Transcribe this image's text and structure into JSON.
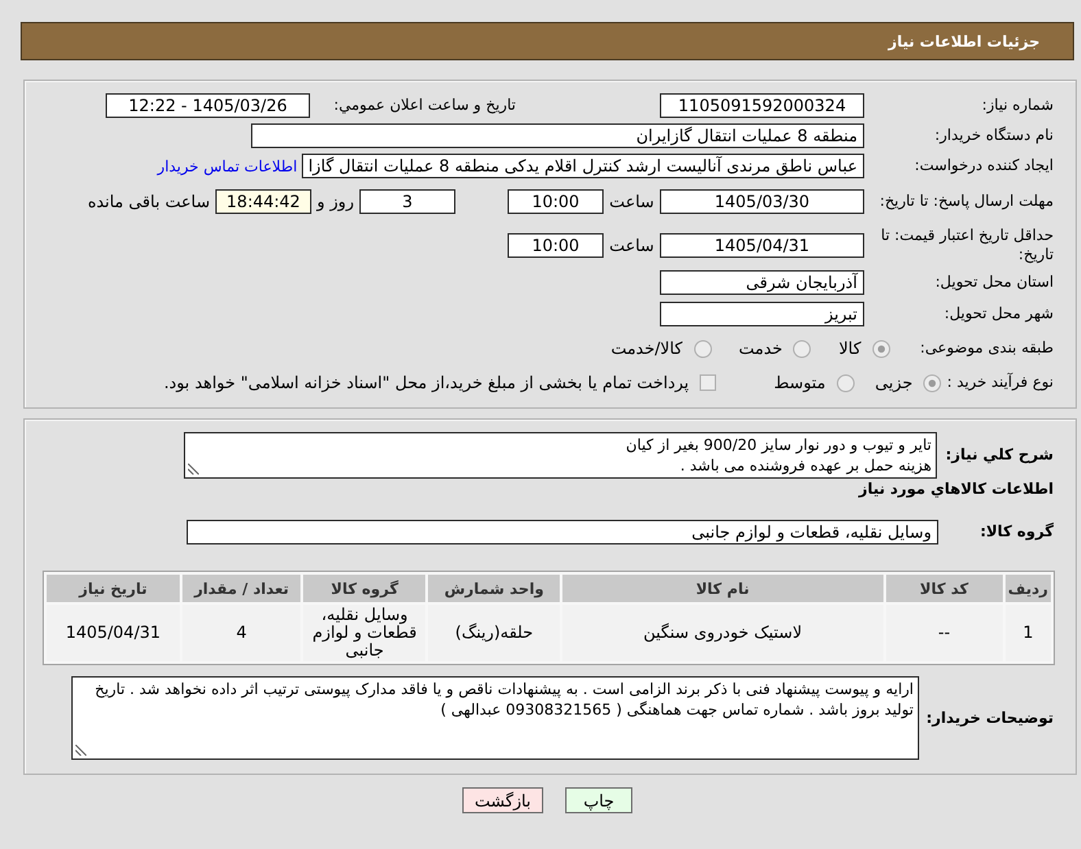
{
  "header": {
    "title": "جزئیات اطلاعات نیاز"
  },
  "need_number": {
    "label": "شماره نیاز:",
    "value": "1105091592000324"
  },
  "announce": {
    "label": "تاریخ و ساعت اعلان عمومي:",
    "value": "1405/03/26 - 12:22"
  },
  "buyer_org": {
    "label": "نام دستگاه خریدار:",
    "value": "منطقه 8 عملیات انتقال گازایران"
  },
  "requester": {
    "label": "ایجاد کننده درخواست:",
    "value": "عباس ناطق مرندی آنالیست ارشد کنترل اقلام یدکی منطقه 8 عملیات انتقال گازا",
    "link": "اطلاعات تماس خریدار"
  },
  "deadline": {
    "label": "مهلت ارسال پاسخ: تا تاریخ:",
    "date": "1405/03/30",
    "time_label": "ساعت",
    "time": "10:00",
    "days": "3",
    "days_label": "روز و",
    "remaining": "18:44:42",
    "remaining_label": "ساعت باقی مانده"
  },
  "price_validity": {
    "label": "حداقل تاریخ اعتبار قیمت: تا تاریخ:",
    "date": "1405/04/31",
    "time_label": "ساعت",
    "time": "10:00"
  },
  "province": {
    "label": "استان محل تحویل:",
    "value": "آذربایجان شرقی"
  },
  "city": {
    "label": "شهر محل تحویل:",
    "value": "تبریز"
  },
  "category": {
    "label": "طبقه بندی موضوعی:",
    "options": [
      {
        "label": "کالا",
        "selected": true
      },
      {
        "label": "خدمت",
        "selected": false
      },
      {
        "label": "کالا/خدمت",
        "selected": false
      }
    ]
  },
  "process": {
    "label": "نوع فرآیند خرید :",
    "options": [
      {
        "label": "جزیی",
        "selected": true
      },
      {
        "label": "متوسط",
        "selected": false
      }
    ],
    "treasury": {
      "label": "پرداخت تمام یا بخشی از مبلغ خرید،از محل \"اسناد خزانه اسلامی\" خواهد بود.",
      "checked": false
    }
  },
  "description": {
    "label": "شرح کلي نیاز:",
    "value": "تایر و تیوب و دور نوار سایز 900/20 بغیر از کیان\nهزینه حمل بر عهده فروشنده می باشد ."
  },
  "items_heading": "اطلاعات کالاهاي مورد نياز",
  "goods_group": {
    "label": "گروه کالا:",
    "value": "وسایل نقلیه، قطعات و لوازم جانبی"
  },
  "table": {
    "columns": [
      "ردیف",
      "کد کالا",
      "نام کالا",
      "واحد شمارش",
      "گروه کالا",
      "تعداد / مقدار",
      "تاریخ نیاز"
    ],
    "rows": [
      {
        "cells": [
          "1",
          "--",
          "لاستیک خودروی سنگین",
          "حلقه(رینگ)",
          "وسایل نقلیه، قطعات و لوازم جانبی",
          "4",
          "1405/04/31"
        ]
      }
    ]
  },
  "buyer_notes": {
    "label": "توضیحات خریدار:",
    "value": "ارایه و پیوست پیشنهاد فنی با ذکر برند الزامی است . به پیشنهادات ناقص و یا فاقد مدارک پیوستی ترتیب اثر داده نخواهد شد . تاریخ تولید بروز باشد . شماره تماس جهت هماهنگی ( 09308321565 عبدالهی )"
  },
  "buttons": [
    {
      "label": "چاپ",
      "kind": "print"
    },
    {
      "label": "بازگشت",
      "kind": "back"
    }
  ]
}
